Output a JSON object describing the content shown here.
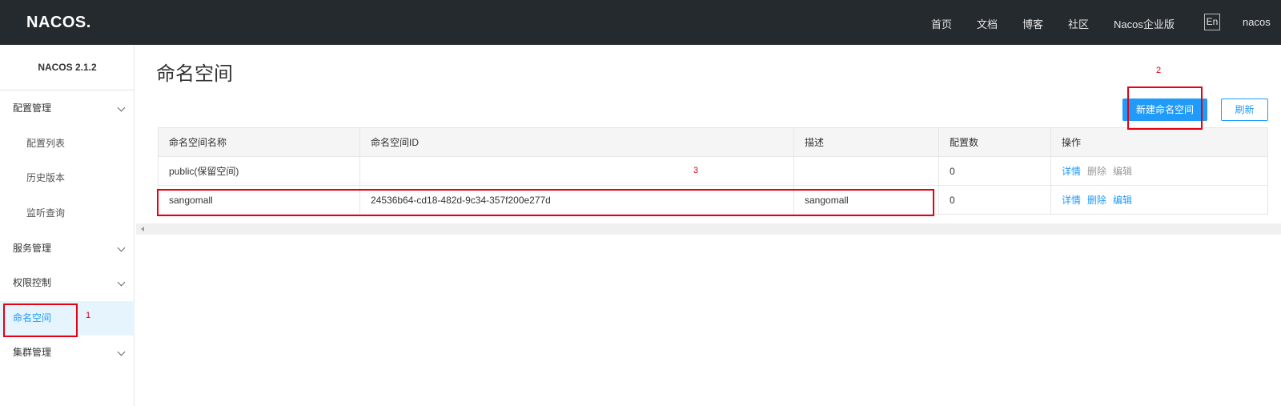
{
  "header": {
    "logo": "NACOS.",
    "nav": [
      "首页",
      "文档",
      "博客",
      "社区",
      "Nacos企业版"
    ],
    "lang": "En",
    "user": "nacos"
  },
  "sidebar": {
    "version": "NACOS 2.1.2",
    "items": [
      {
        "label": "配置管理"
      },
      {
        "label": "配置列表"
      },
      {
        "label": "历史版本"
      },
      {
        "label": "监听查询"
      },
      {
        "label": "服务管理"
      },
      {
        "label": "权限控制"
      },
      {
        "label": "命名空间"
      },
      {
        "label": "集群管理"
      }
    ]
  },
  "main": {
    "title": "命名空间",
    "new_button": "新建命名空间",
    "refresh_button": "刷新",
    "columns": [
      "命名空间名称",
      "命名空间ID",
      "描述",
      "配置数",
      "操作"
    ],
    "rows": [
      {
        "name": "public(保留空间)",
        "id": "",
        "desc": "",
        "count": "0",
        "ops": [
          "详情",
          "删除",
          "编辑"
        ]
      },
      {
        "name": "sangomall",
        "id": "24536b64-cd18-482d-9c34-357f200e277d",
        "desc": "sangomall",
        "count": "0",
        "ops": [
          "详情",
          "删除",
          "编辑"
        ]
      }
    ]
  },
  "annotations": [
    "1",
    "2",
    "3"
  ]
}
